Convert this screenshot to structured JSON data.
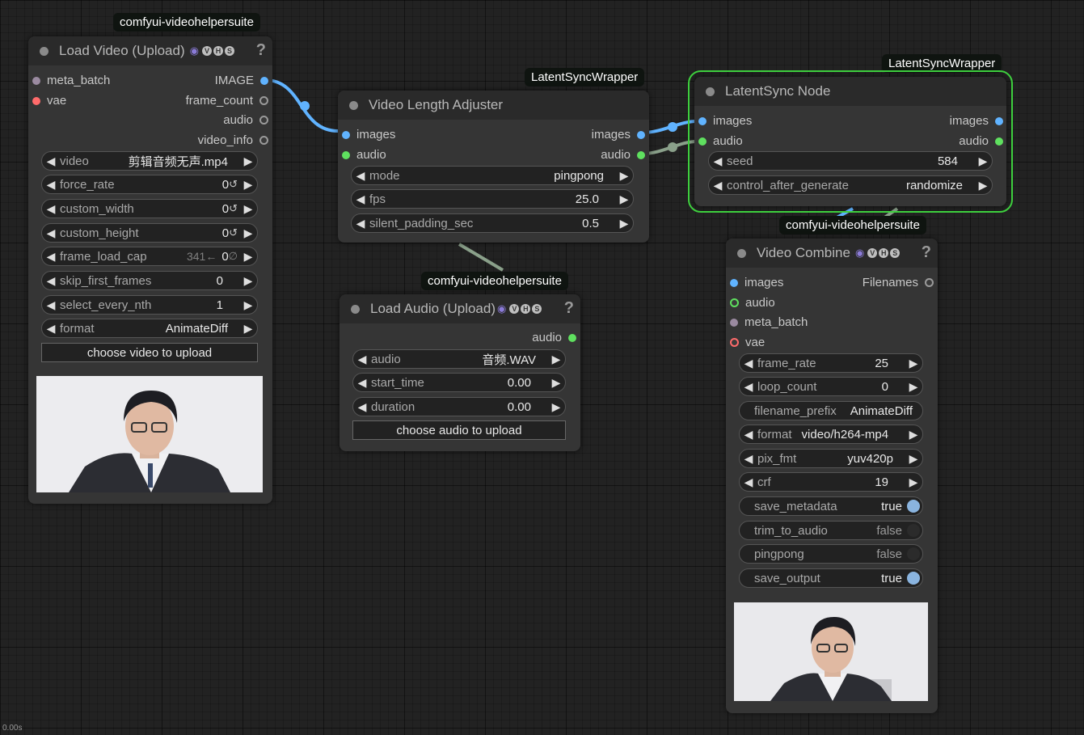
{
  "status": {
    "timer": "0.00s"
  },
  "nodes": {
    "load_video": {
      "pack": "comfyui-videohelpersuite",
      "title": "Load Video (Upload)",
      "help": "?",
      "inputs": [
        "meta_batch",
        "vae"
      ],
      "outputs": [
        "IMAGE",
        "frame_count",
        "audio",
        "video_info"
      ],
      "widgets": {
        "video": {
          "label": "video",
          "value": "剪辑音频无声.mp4"
        },
        "force_rate": {
          "label": "force_rate",
          "value": "0"
        },
        "custom_width": {
          "label": "custom_width",
          "value": "0"
        },
        "custom_height": {
          "label": "custom_height",
          "value": "0"
        },
        "frame_load_cap": {
          "label": "frame_load_cap",
          "value": "0",
          "hint": "341←"
        },
        "skip_first_frames": {
          "label": "skip_first_frames",
          "value": "0"
        },
        "select_every_nth": {
          "label": "select_every_nth",
          "value": "1"
        },
        "format": {
          "label": "format",
          "value": "AnimateDiff"
        }
      },
      "upload_label": "choose video to upload"
    },
    "video_length_adjuster": {
      "pack": "LatentSyncWrapper",
      "title": "Video Length Adjuster",
      "inputs": [
        "images",
        "audio"
      ],
      "outputs": [
        "images",
        "audio"
      ],
      "widgets": {
        "mode": {
          "label": "mode",
          "value": "pingpong"
        },
        "fps": {
          "label": "fps",
          "value": "25.0"
        },
        "silent_padding_sec": {
          "label": "silent_padding_sec",
          "value": "0.5"
        }
      }
    },
    "latentsync": {
      "pack": "LatentSyncWrapper",
      "title": "LatentSync Node",
      "inputs": [
        "images",
        "audio"
      ],
      "outputs": [
        "images",
        "audio"
      ],
      "widgets": {
        "seed": {
          "label": "seed",
          "value": "584"
        },
        "control_after_generate": {
          "label": "control_after_generate",
          "value": "randomize"
        }
      }
    },
    "load_audio": {
      "pack": "comfyui-videohelpersuite",
      "title": "Load Audio (Upload)",
      "help": "?",
      "outputs": [
        "audio"
      ],
      "widgets": {
        "audio": {
          "label": "audio",
          "value": "音频.WAV"
        },
        "start_time": {
          "label": "start_time",
          "value": "0.00"
        },
        "duration": {
          "label": "duration",
          "value": "0.00"
        }
      },
      "upload_label": "choose audio to upload"
    },
    "video_combine": {
      "pack": "comfyui-videohelpersuite",
      "title": "Video Combine",
      "help": "?",
      "inputs": [
        "images",
        "audio",
        "meta_batch",
        "vae"
      ],
      "outputs": [
        "Filenames"
      ],
      "widgets": {
        "frame_rate": {
          "label": "frame_rate",
          "value": "25"
        },
        "loop_count": {
          "label": "loop_count",
          "value": "0"
        },
        "filename_prefix": {
          "label": "filename_prefix",
          "value": "AnimateDiff"
        },
        "format": {
          "label": "format",
          "value": "video/h264-mp4"
        },
        "pix_fmt": {
          "label": "pix_fmt",
          "value": "yuv420p"
        },
        "crf": {
          "label": "crf",
          "value": "19"
        },
        "save_metadata": {
          "label": "save_metadata",
          "value": "true",
          "on": true
        },
        "trim_to_audio": {
          "label": "trim_to_audio",
          "value": "false",
          "on": false
        },
        "pingpong": {
          "label": "pingpong",
          "value": "false",
          "on": false
        },
        "save_output": {
          "label": "save_output",
          "value": "true",
          "on": true
        }
      }
    }
  },
  "badges": [
    "V",
    "H",
    "S"
  ],
  "colors": {
    "canvas": "#222222",
    "node_bg": "#353535",
    "node_header": "#2a2a2a",
    "image_link": "#60b3ff",
    "audio_link": "#5fe05f",
    "selected_outline": "#3ecf3e"
  }
}
